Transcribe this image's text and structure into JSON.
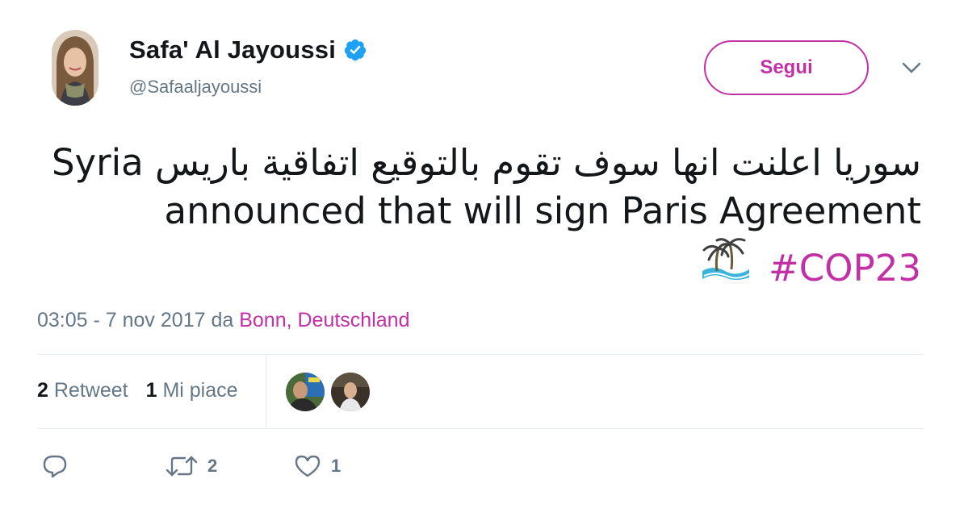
{
  "author": {
    "name": "Safa' Al Jayoussi",
    "handle": "@Safaaljayoussi",
    "verified": true
  },
  "follow_label": "Segui",
  "tweet": {
    "line1": "سوريا اعلنت انها سوف تقوم بالتوقيع اتفاقية باريس  Syria",
    "line2": "announced that will sign Paris Agreement",
    "emoji": "desert-island-palm-icon",
    "hashtag": "#COP23"
  },
  "meta": {
    "time_date": "03:05 - 7 nov 2017",
    "da": "da",
    "location": "Bonn, Deutschland"
  },
  "stats": {
    "retweet_count": "2",
    "retweet_label": "Retweet",
    "like_count": "1",
    "like_label": "Mi piace"
  },
  "actions": {
    "reply_count": "",
    "retweet_count": "2",
    "like_count": "1"
  },
  "colors": {
    "accent": "#c230a5",
    "muted": "#657786",
    "verified": "#1da1f2"
  }
}
